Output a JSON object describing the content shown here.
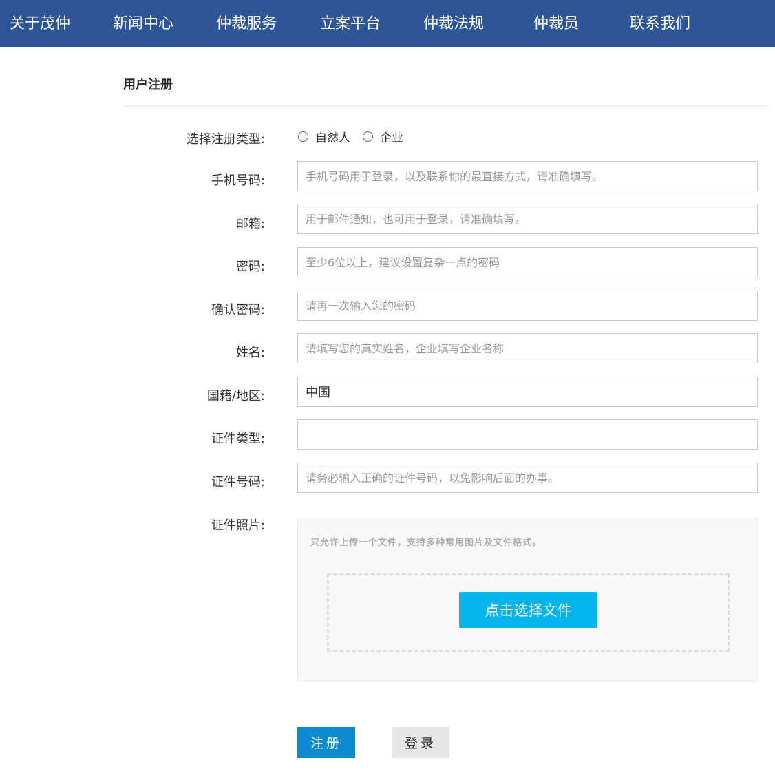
{
  "nav": {
    "items": [
      "关于茂仲",
      "新闻中心",
      "仲裁服务",
      "立案平台",
      "仲裁法规",
      "仲裁员",
      "联系我们"
    ]
  },
  "page": {
    "title": "用户注册"
  },
  "form": {
    "reg_type": {
      "label": "选择注册类型:",
      "options": [
        "自然人",
        "企业"
      ]
    },
    "phone": {
      "label": "手机号码:",
      "placeholder": "手机号码用于登录，以及联系你的最直接方式，请准确填写。"
    },
    "email": {
      "label": "邮箱:",
      "placeholder": "用于邮件通知，也可用于登录，请准确填写。"
    },
    "password": {
      "label": "密码:",
      "placeholder": "至少6位以上，建议设置复杂一点的密码"
    },
    "confirm_password": {
      "label": "确认密码:",
      "placeholder": "请再一次输入您的密码"
    },
    "name": {
      "label": "姓名:",
      "placeholder": "请填写您的真实姓名，企业填写企业名称"
    },
    "nationality": {
      "label": "国籍/地区:",
      "value": "中国"
    },
    "id_type": {
      "label": "证件类型:",
      "value": ""
    },
    "id_number": {
      "label": "证件号码:",
      "placeholder": "请务必输入正确的证件号码，以免影响后面的办事。"
    },
    "id_photo": {
      "label": "证件照片:",
      "hint": "只允许上传一个文件，支持多种常用图片及文件格式。",
      "button_label": "点击选择文件"
    }
  },
  "actions": {
    "register_label": "注册",
    "login_label": "登录"
  },
  "colors": {
    "nav_bg": "#2e5597",
    "upload_button": "#06b4ec",
    "register_button": "#0d8bd0",
    "login_button": "#e6e6e6"
  }
}
